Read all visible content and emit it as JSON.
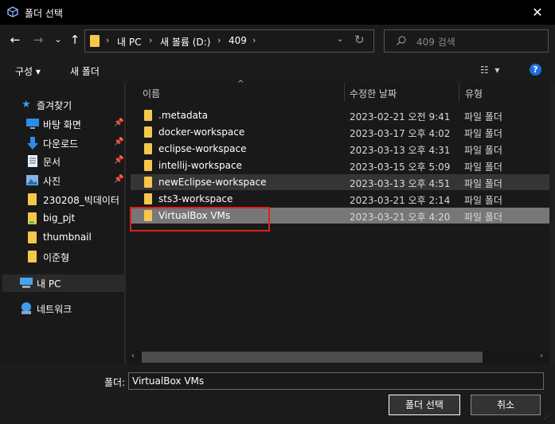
{
  "window": {
    "title": "폴더 선택",
    "close_label": "✕"
  },
  "nav": {
    "back": "←",
    "forward": "→",
    "recent": "⌄",
    "up": "↑",
    "breadcrumbs": [
      "내 PC",
      "새 볼륨 (D:)",
      "409"
    ],
    "refresh": "↻",
    "search_placeholder": "409 검색"
  },
  "toolbar": {
    "organize_label": "구성 ▾",
    "new_folder_label": "새 폴더",
    "help_label": "?"
  },
  "sidebar": {
    "items": [
      {
        "label": "즐겨찾기",
        "icon": "star-icon"
      },
      {
        "label": "바탕 화면",
        "icon": "desktop-icon",
        "pinned": true
      },
      {
        "label": "다운로드",
        "icon": "download-icon",
        "pinned": true
      },
      {
        "label": "문서",
        "icon": "document-icon",
        "pinned": true
      },
      {
        "label": "사진",
        "icon": "picture-icon",
        "pinned": true
      },
      {
        "label": "230208_빅데이터",
        "icon": "folder-icon"
      },
      {
        "label": "big_pjt",
        "icon": "folder-icon"
      },
      {
        "label": "thumbnail",
        "icon": "folder-icon"
      },
      {
        "label": "이준형",
        "icon": "folder-icon"
      },
      {
        "label": "내 PC",
        "icon": "pc-icon",
        "selected": true
      },
      {
        "label": "네트워크",
        "icon": "network-icon"
      }
    ]
  },
  "columns": {
    "name": "이름",
    "modified": "수정한 날짜",
    "type": "유형"
  },
  "rows": [
    {
      "name": ".metadata",
      "modified": "2023-02-21 오전 9:41",
      "type": "파일 폴더"
    },
    {
      "name": "docker-workspace",
      "modified": "2023-03-17 오후 4:02",
      "type": "파일 폴더"
    },
    {
      "name": "eclipse-workspace",
      "modified": "2023-03-13 오후 4:31",
      "type": "파일 폴더"
    },
    {
      "name": "intellij-workspace",
      "modified": "2023-03-15 오후 5:09",
      "type": "파일 폴더"
    },
    {
      "name": "newEclipse-workspace",
      "modified": "2023-03-13 오후 4:51",
      "type": "파일 폴더"
    },
    {
      "name": "sts3-workspace",
      "modified": "2023-03-21 오후 2:14",
      "type": "파일 폴더"
    },
    {
      "name": "VirtualBox VMs",
      "modified": "2023-03-21 오후 4:20",
      "type": "파일 폴더"
    }
  ],
  "footer": {
    "folder_label": "폴더:",
    "folder_value": "VirtualBox VMs",
    "select_button": "폴더 선택",
    "cancel_button": "취소"
  },
  "colors": {
    "accent": "#1d6fd6",
    "folder": "#f5c84c",
    "highlight": "#e0201a",
    "selected_row": "#777777"
  }
}
